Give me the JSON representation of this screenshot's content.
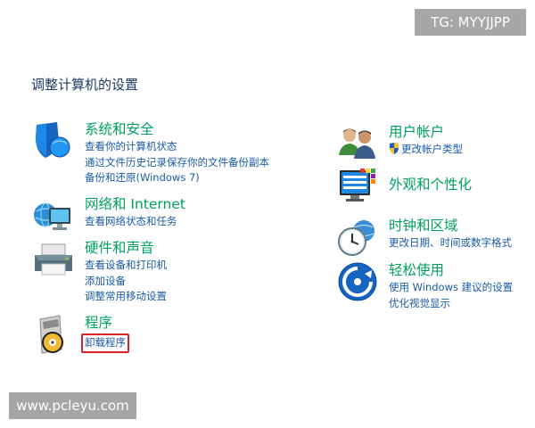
{
  "watermarks": {
    "top": "TG: MYYJJPP",
    "bottom": "www.pcleyu.com"
  },
  "page_title": "调整计算机的设置",
  "categories_left": [
    {
      "title": "系统和安全",
      "icon": "shield-icon",
      "links": [
        "查看你的计算机状态",
        "通过文件历史记录保存你的文件备份副本",
        "备份和还原(Windows 7)"
      ]
    },
    {
      "title": "网络和 Internet",
      "icon": "network-globe-icon",
      "links": [
        "查看网络状态和任务"
      ]
    },
    {
      "title": "硬件和声音",
      "icon": "printer-icon",
      "links": [
        "查看设备和打印机",
        "添加设备",
        "调整常用移动设置"
      ]
    },
    {
      "title": "程序",
      "icon": "programs-disc-icon",
      "links": [
        "卸载程序"
      ]
    }
  ],
  "categories_right": [
    {
      "title": "用户帐户",
      "icon": "users-icon",
      "links": [
        "更改帐户类型"
      ]
    },
    {
      "title": "外观和个性化",
      "icon": "monitor-palette-icon",
      "links": []
    },
    {
      "title": "时钟和区域",
      "icon": "clock-globe-icon",
      "links": [
        "更改日期、时间或数字格式"
      ]
    },
    {
      "title": "轻松使用",
      "icon": "ease-of-access-icon",
      "links": [
        "使用 Windows 建议的设置",
        "优化视觉显示"
      ]
    }
  ],
  "colors": {
    "category_title": "#00a060",
    "link": "#1a5aa6",
    "highlight_border": "#d9232a"
  }
}
